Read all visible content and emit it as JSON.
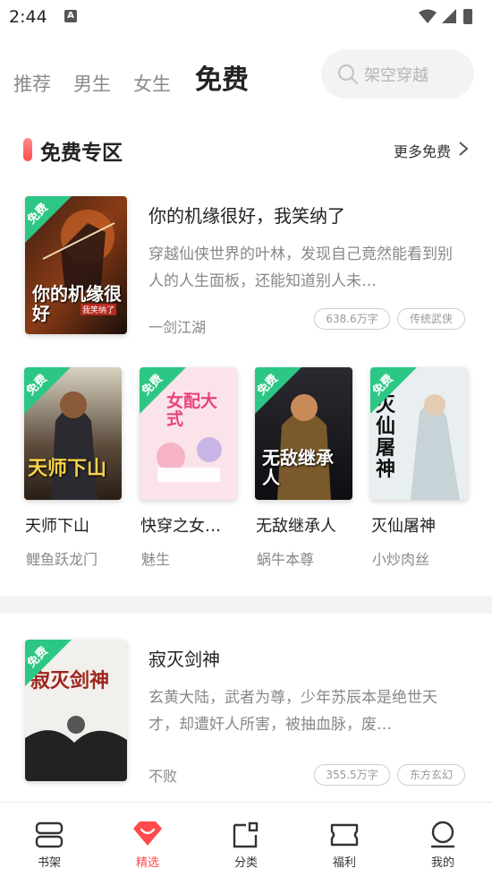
{
  "status_bar": {
    "time": "2:44",
    "notification_glyph": "A"
  },
  "tabs": [
    {
      "label": "推荐",
      "active": false
    },
    {
      "label": "男生",
      "active": false
    },
    {
      "label": "女生",
      "active": false
    },
    {
      "label": "免费",
      "active": true
    }
  ],
  "search": {
    "placeholder": "架空穿越"
  },
  "section": {
    "title": "免费专区",
    "more": "更多免费"
  },
  "badge_text": "免费",
  "featured": [
    {
      "title": "你的机缘很好，我笑纳了",
      "description": "穿越仙侠世界的叶林，发现自己竟然能看到别人的人生面板，还能知道别人未…",
      "author": "一剑江湖",
      "word_count": "638.6万字",
      "genre": "传统武侠",
      "cover_text": "你的机缘很好",
      "cover_sub": "我笑纳了"
    },
    {
      "title": "寂灭剑神",
      "description": "玄黄大陆，武者为尊，少年苏辰本是绝世天才，却遭奸人所害，被抽血脉，废…",
      "author": "不败",
      "word_count": "355.5万字",
      "genre": "东方玄幻",
      "cover_text": "寂灭剑神"
    }
  ],
  "grid_books": [
    {
      "title": "天师下山",
      "author": "鲤鱼跃龙门",
      "cover_text": "天师下山"
    },
    {
      "title": "快穿之女…",
      "author": "魅生",
      "cover_text": "女配大式"
    },
    {
      "title": "无敌继承人",
      "author": "蜗牛本尊",
      "cover_text": "无敌继承人"
    },
    {
      "title": "灭仙屠神",
      "author": "小炒肉丝",
      "cover_text": "灭仙屠神"
    }
  ],
  "bottom_nav": [
    {
      "label": "书架",
      "icon": "bookshelf-icon",
      "active": false
    },
    {
      "label": "精选",
      "icon": "featured-gem-icon",
      "active": true
    },
    {
      "label": "分类",
      "icon": "category-icon",
      "active": false
    },
    {
      "label": "福利",
      "icon": "ticket-icon",
      "active": false
    },
    {
      "label": "我的",
      "icon": "profile-icon",
      "active": false
    }
  ],
  "colors": {
    "accent": "#ff4b4b",
    "badge": "#2dc785",
    "muted": "#888888"
  }
}
